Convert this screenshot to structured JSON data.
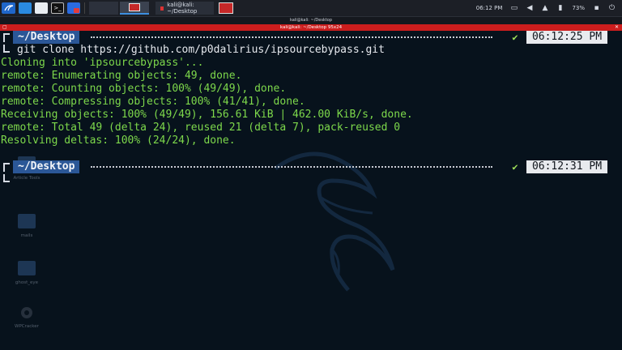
{
  "panel": {
    "launcher_icons": [
      "kali-menu-icon",
      "files-blue-icon",
      "folder-white-icon",
      "terminal-icon",
      "browser-icon"
    ],
    "task_label": "kali@kali: ~/Desktop",
    "clock": "06:12 PM",
    "battery": "73%"
  },
  "window": {
    "wm_title": "kali@kali: ~/Desktop",
    "term_title": "kali@kali: ~/Desktop 95x24"
  },
  "desktop_icons": [
    "Article Tools",
    "mails",
    "ghost_eye",
    "WPCracker"
  ],
  "prompt1": {
    "dir": "~/Desktop",
    "time": "06:12:25 PM"
  },
  "command": "git clone https://github.com/p0dalirius/ipsourcebypass.git",
  "output": [
    "Cloning into 'ipsourcebypass'...",
    "remote: Enumerating objects: 49, done.",
    "remote: Counting objects: 100% (49/49), done.",
    "remote: Compressing objects: 100% (41/41), done.",
    "Receiving objects: 100% (49/49), 156.61 KiB | 462.00 KiB/s, done.",
    "remote: Total 49 (delta 24), reused 21 (delta 7), pack-reused 0",
    "Resolving deltas: 100% (24/24), done."
  ],
  "prompt2": {
    "dir": "~/Desktop",
    "time": "06:12:31 PM"
  },
  "colors": {
    "accent": "#2b5797",
    "output_text": "#7dd84b",
    "title_bar": "#cc1d1d",
    "background": "#07121c"
  }
}
